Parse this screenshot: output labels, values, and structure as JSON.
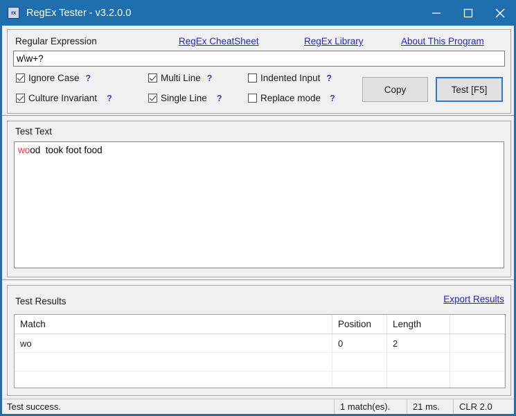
{
  "window": {
    "title": "RegEx Tester - v3.2.0.0",
    "icon_label": "rx",
    "icon_name": "app-icon-regex",
    "accent_color": "#1f6eae",
    "controls": {
      "minimize": "minimize-icon",
      "maximize": "maximize-icon",
      "close": "close-icon"
    }
  },
  "regex_section": {
    "label": "Regular Expression",
    "links": [
      {
        "label": "RegEx CheatSheet"
      },
      {
        "label": "RegEx Library"
      },
      {
        "label": "About This Program"
      }
    ],
    "input": {
      "value": "w\\w+?",
      "placeholder": ""
    },
    "options": [
      {
        "label": "Ignore Case",
        "checked": true,
        "help": "?"
      },
      {
        "label": "Multi Line",
        "checked": true,
        "help": "?"
      },
      {
        "label": "Indented Input",
        "checked": false,
        "help": "?"
      },
      {
        "label": "Culture Invariant",
        "checked": true,
        "help": "?"
      },
      {
        "label": "Single Line",
        "checked": true,
        "help": "?"
      },
      {
        "label": "Replace mode",
        "checked": false,
        "help": "?"
      }
    ],
    "buttons": {
      "copy": "Copy",
      "test": "Test [F5]"
    }
  },
  "test_text": {
    "label": "Test Text",
    "match_part": "wo",
    "rest_part": "od  took foot food",
    "full_text": "wood  took foot food",
    "match_color": "#ff2d2d"
  },
  "test_results": {
    "label": "Test Results",
    "export_link": "Export Results",
    "columns": [
      "Match",
      "Position",
      "Length",
      ""
    ],
    "rows": [
      {
        "match": "wo",
        "position": "0",
        "length": "2",
        "extra": ""
      },
      {
        "match": "",
        "position": "",
        "length": "",
        "extra": ""
      },
      {
        "match": "",
        "position": "",
        "length": "",
        "extra": ""
      },
      {
        "match": "",
        "position": "",
        "length": "",
        "extra": ""
      }
    ]
  },
  "status_bar": {
    "status": "Test success.",
    "matches": "1 match(es).",
    "time": "21 ms.",
    "runtime": "CLR 2.0"
  }
}
